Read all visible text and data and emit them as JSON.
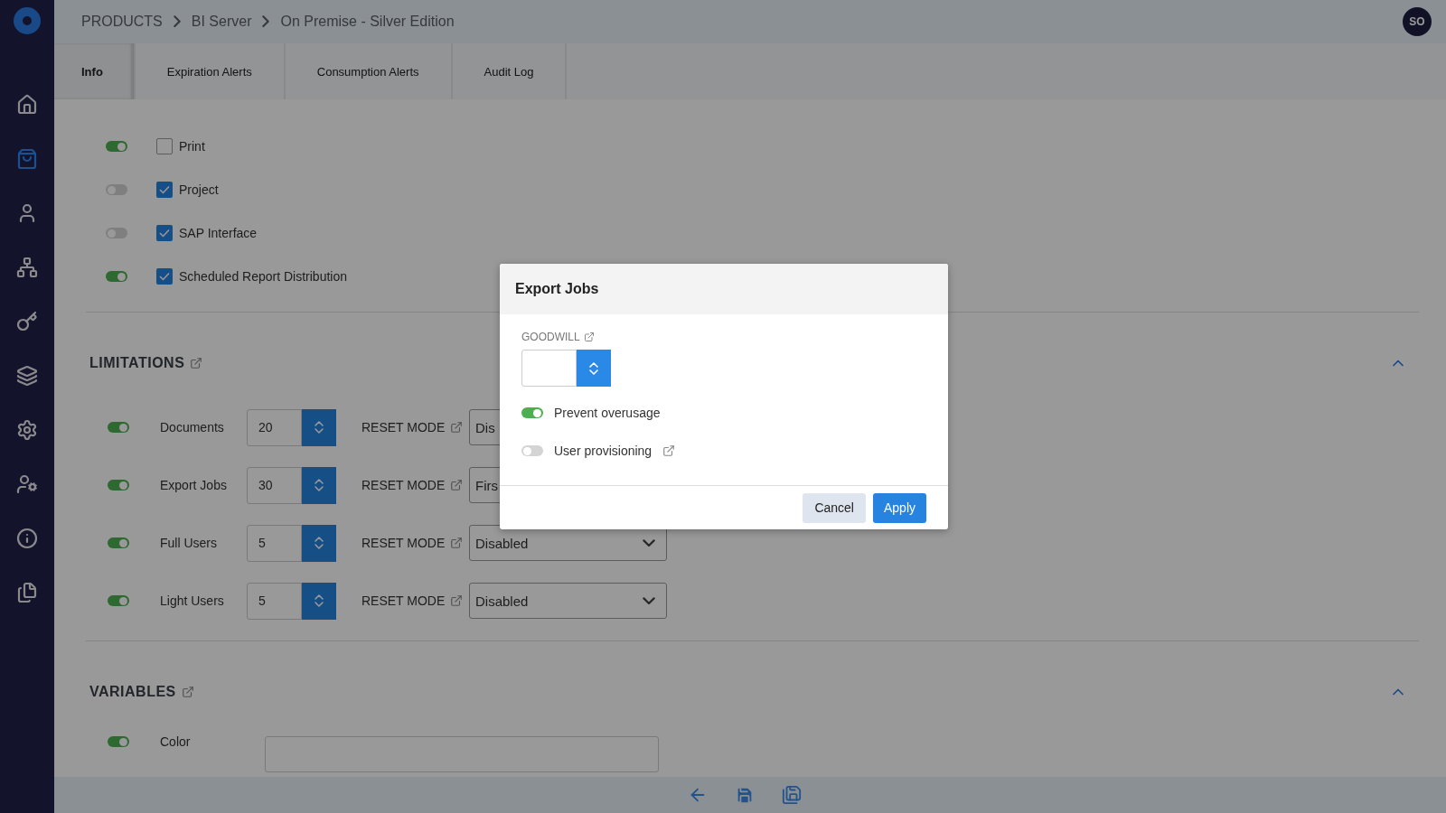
{
  "sidebar": {
    "items": [
      {
        "selected": false
      },
      {
        "selected": true
      },
      {
        "selected": false
      },
      {
        "selected": false
      },
      {
        "selected": false
      },
      {
        "selected": false
      },
      {
        "selected": false
      },
      {
        "selected": false
      },
      {
        "selected": false
      },
      {
        "selected": false
      }
    ]
  },
  "breadcrumb": [
    "PRODUCTS",
    "BI Server",
    "On Premise - Silver Edition"
  ],
  "avatar": {
    "initials": "SO"
  },
  "tabs": [
    {
      "label": "Info",
      "selected": true
    },
    {
      "label": "Expiration Alerts",
      "selected": false
    },
    {
      "label": "Consumption Alerts",
      "selected": false
    },
    {
      "label": "Audit Log",
      "selected": false
    }
  ],
  "features": [
    {
      "label": "Print",
      "enabled": true,
      "checked": false
    },
    {
      "label": "Project",
      "enabled": false,
      "checked": true
    },
    {
      "label": "SAP Interface",
      "enabled": false,
      "checked": true
    },
    {
      "label": "Scheduled Report Distribution",
      "enabled": true,
      "checked": true
    }
  ],
  "limitations": {
    "title": "LIMITATIONS",
    "expanded": true,
    "rows": [
      {
        "label": "Documents",
        "enabled": true,
        "value": "20",
        "reset_label": "RESET MODE",
        "mode": "Dis"
      },
      {
        "label": "Export Jobs",
        "enabled": true,
        "value": "30",
        "reset_label": "RESET MODE",
        "mode": "Firs"
      },
      {
        "label": "Full Users",
        "enabled": true,
        "value": "5",
        "reset_label": "RESET MODE",
        "mode": "Disabled"
      },
      {
        "label": "Light Users",
        "enabled": true,
        "value": "5",
        "reset_label": "RESET MODE",
        "mode": "Disabled"
      }
    ]
  },
  "variables": {
    "title": "VARIABLES",
    "expanded": true,
    "rows": [
      {
        "label": "Color",
        "enabled": true
      }
    ]
  },
  "dialog": {
    "title": "Export Jobs",
    "field_label": "GOODWILL",
    "options": [
      {
        "label": "Prevent overusage",
        "on": true,
        "link": false
      },
      {
        "label": "User provisioning",
        "on": false,
        "link": true
      }
    ],
    "buttons": [
      {
        "label": "Cancel",
        "kind": "secondary"
      },
      {
        "label": "Apply",
        "kind": "primary"
      }
    ]
  }
}
